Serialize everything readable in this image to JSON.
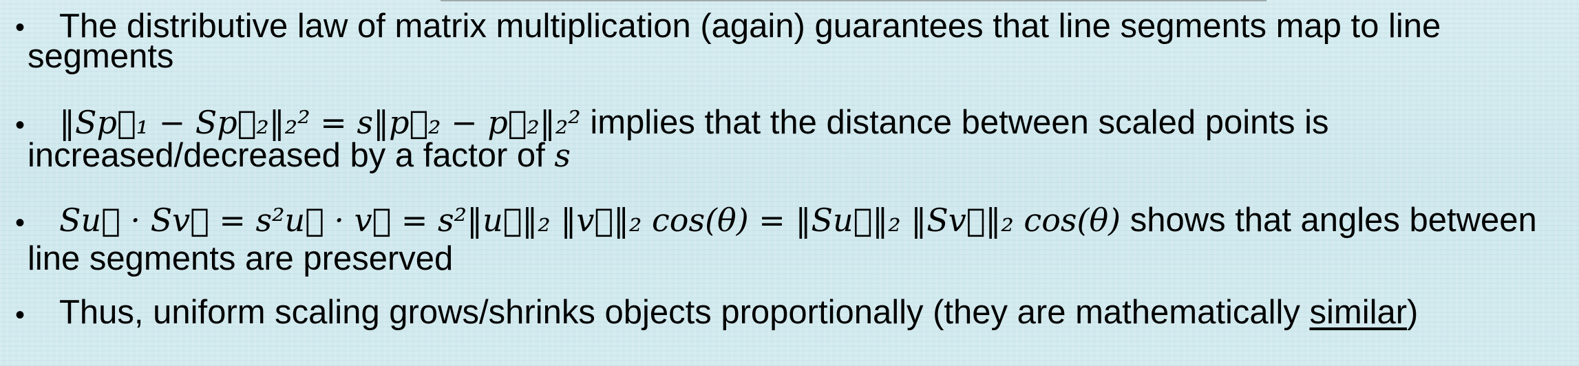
{
  "bullets": [
    {
      "line1": "The distributive law of matrix multiplication (again) guarantees that line segments map to line",
      "line2": "segments"
    },
    {
      "formula": "‖Sp⃗₁ − Sp⃗₂‖₂² = s‖p⃗₂ − p⃗₂‖₂²",
      "line1_text": " implies that the distance between scaled points is",
      "line2_text": "increased/decreased by a factor of ",
      "line2_math": "s"
    },
    {
      "formula": "Su⃗ · Sv⃗ = s²u⃗ · v⃗ = s²‖u⃗‖₂ ‖v⃗‖₂ cos(θ) = ‖Su⃗‖₂ ‖Sv⃗‖₂ cos(θ)",
      "line1_text": " shows that angles between",
      "line2": "line segments are preserved"
    },
    {
      "line1_pre": "Thus, uniform scaling grows/shrinks objects proportionally (they are mathematically ",
      "underlined": "similar",
      "line1_post": ")"
    }
  ],
  "bullet_glyph": "•"
}
